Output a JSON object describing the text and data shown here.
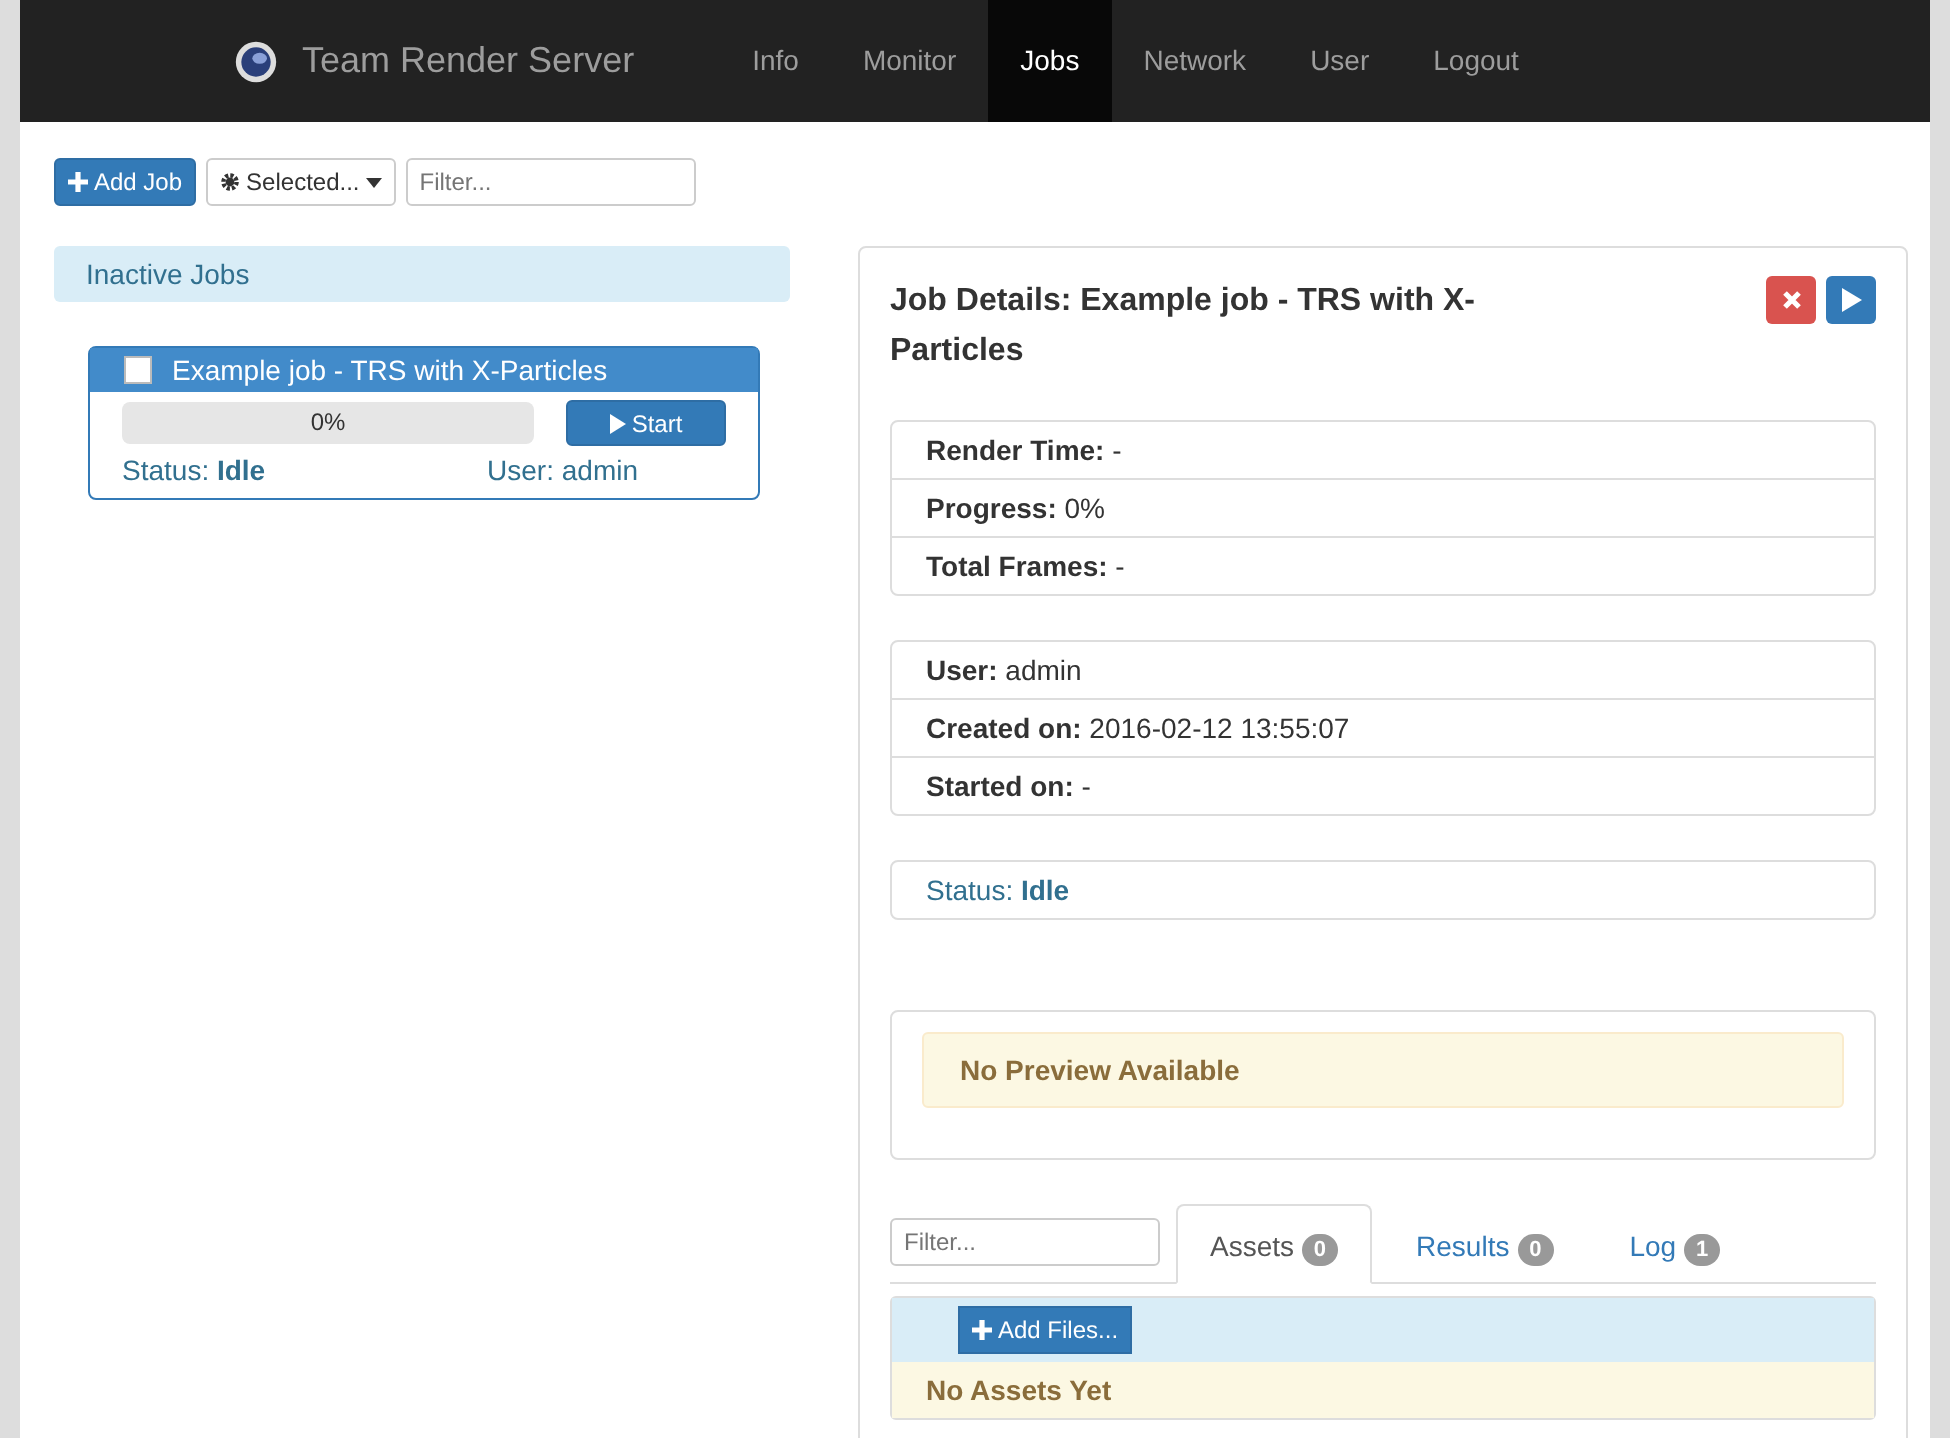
{
  "navbar": {
    "brand": "Team Render Server",
    "items": [
      {
        "label": "Info",
        "selected": false
      },
      {
        "label": "Monitor",
        "selected": false
      },
      {
        "label": "Jobs",
        "selected": true
      },
      {
        "label": "Network",
        "selected": false
      },
      {
        "label": "User",
        "selected": false
      },
      {
        "label": "Logout",
        "selected": false
      }
    ]
  },
  "toolbar": {
    "add_job": "Add Job",
    "selected_menu": "Selected...",
    "filter": {
      "placeholder": "Filter..."
    }
  },
  "job_list": {
    "heading": "Inactive Jobs",
    "jobs": [
      {
        "name": "Example job - TRS with X-Particles",
        "checked": false,
        "level": 0,
        "progress": "0%",
        "start": "Start",
        "status": "Status: **Idle**",
        "user": "User: admin"
      }
    ]
  },
  "details": {
    "title": "Job Details: Example job - TRS with X-Particles",
    "groups": [
      [
        "**Render Time:** -",
        "**Progress:** 0%",
        "**Total Frames:** -"
      ],
      [
        "**User:** admin",
        "**Created on:** 2016-02-12 13:55:07",
        "**Started on:** -"
      ]
    ],
    "status": "Status: **Idle**",
    "preview": "No Preview Available",
    "filter": {
      "placeholder": "Filter..."
    },
    "tabs": [
      {
        "label": "Assets",
        "count": "0",
        "selected": true
      },
      {
        "label": "Results",
        "count": "0",
        "selected": false
      },
      {
        "label": "Log",
        "count": "1",
        "selected": false
      }
    ],
    "add_files": "Add Files...",
    "empty": "No Assets Yet"
  }
}
